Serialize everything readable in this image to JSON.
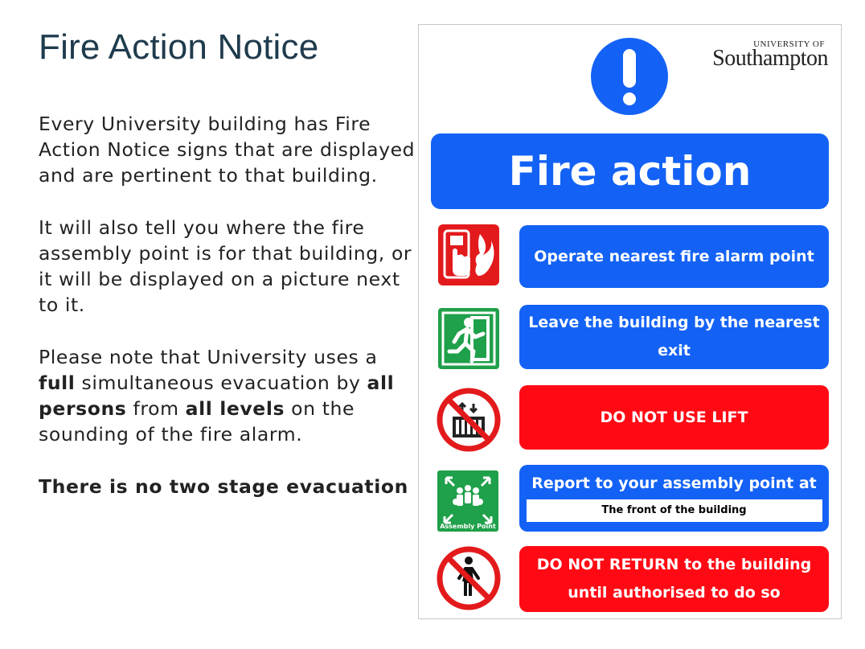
{
  "slide": {
    "title": "Fire Action Notice",
    "para1": "Every University building has Fire Action Notice signs that are displayed and are pertinent to that building.",
    "para2": "It will also tell you where the fire assembly point is for that building, or it will be displayed on a picture next to it.",
    "para3": {
      "t1": "Please note that University uses  a ",
      "b1": "full",
      "t2": " simultaneous evacuation by ",
      "b2": "all persons",
      "t3": " from ",
      "b3": "all levels",
      "t4": " on the sounding of the fire alarm."
    },
    "para4": "There is no two stage evacuation"
  },
  "notice": {
    "logo_small": "UNIVERSITY OF",
    "logo_big": "Southampton",
    "banner": "Fire action",
    "instructions": {
      "alarm": "Operate nearest fire alarm point",
      "leave": "Leave the building by the nearest exit",
      "lift": "DO NOT USE LIFT",
      "report": "Report to your assembly point at",
      "assembly_location": "The front of the building",
      "return": "DO NOT RETURN to the building until authorised to do so"
    },
    "assembly_icon_label": "Assembly Point",
    "colors": {
      "blue": "#1462f5",
      "red": "#ff0a14",
      "green": "#1fa04a"
    }
  }
}
